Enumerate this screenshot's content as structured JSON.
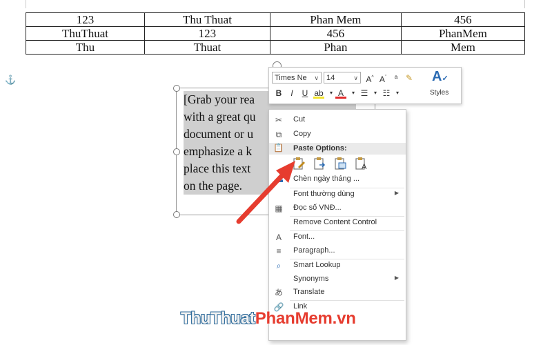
{
  "table": {
    "rows": [
      [
        "123",
        "Thu Thuat",
        "Phan Mem",
        "456"
      ],
      [
        "ThuThuat",
        "123",
        "456",
        "PhanMem"
      ],
      [
        "Thu",
        "Thuat",
        "Phan",
        "Mem"
      ]
    ]
  },
  "textbox": {
    "lines": [
      "[Grab your rea",
      "with a great qu",
      "document or u",
      "emphasize a k",
      "place this text",
      "on the page."
    ]
  },
  "mini_toolbar": {
    "font_name": "Times Ne",
    "font_size": "14",
    "styles_label": "Styles"
  },
  "context_menu": {
    "items": {
      "cut": "Cut",
      "copy": "Copy",
      "paste_header": "Paste Options:",
      "insert_date": "Chèn ngày tháng ...",
      "font_common": "Font thường dùng",
      "read_vnd": "Đọc số VNĐ...",
      "remove_control": "Remove Content Control",
      "font": "Font...",
      "paragraph": "Paragraph...",
      "smart_lookup": "Smart Lookup",
      "synonyms": "Synonyms",
      "translate": "Translate",
      "link": "Link"
    }
  },
  "watermark": {
    "part1": "ThuThuat",
    "part2": "PhanMem",
    "part3": ".vn"
  },
  "colors": {
    "accent": "#2b6bb3",
    "arrow": "#e63c2f",
    "highlight": "#cfcfcf"
  }
}
